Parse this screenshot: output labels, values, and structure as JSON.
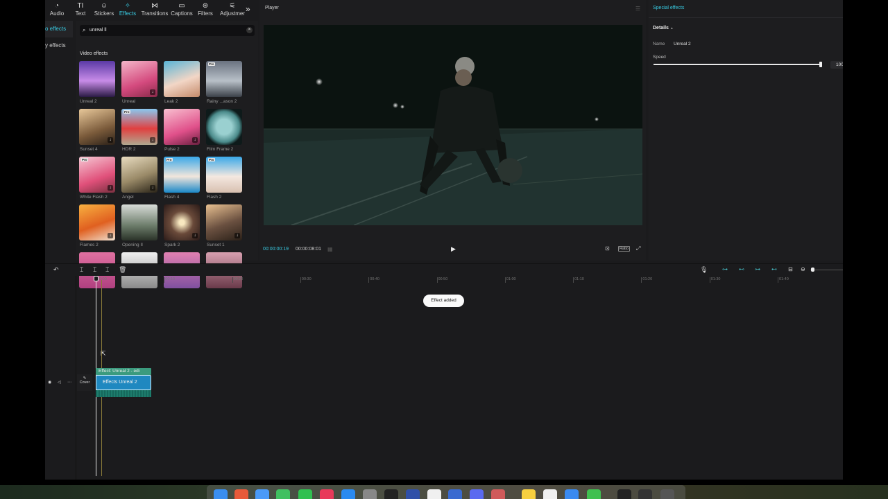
{
  "toolbar": {
    "items": [
      {
        "label": "Audio",
        "icon": "audio-icon",
        "glyph": "◔"
      },
      {
        "label": "Text",
        "icon": "text-icon",
        "glyph": "TI"
      },
      {
        "label": "Stickers",
        "icon": "stickers-icon",
        "glyph": "☺"
      },
      {
        "label": "Effects",
        "icon": "effects-icon",
        "glyph": "✧"
      },
      {
        "label": "Transitions",
        "icon": "transitions-icon",
        "glyph": "⋈"
      },
      {
        "label": "Captions",
        "icon": "captions-icon",
        "glyph": "▭"
      },
      {
        "label": "Filters",
        "icon": "filters-icon",
        "glyph": "⊛"
      },
      {
        "label": "Adjustmer",
        "icon": "adjustment-icon",
        "glyph": "⚟"
      }
    ],
    "more": "»"
  },
  "categories": [
    "o effects",
    "y effects"
  ],
  "search": {
    "value": "unreal ll",
    "clear": "×"
  },
  "section_title": "Video effects",
  "effects": [
    {
      "name": "Unreal 2",
      "bg": "linear-gradient(180deg,#5a3aa6,#c88ce8 55%,#2a1a44)",
      "pro": false,
      "dl": false
    },
    {
      "name": "Unreal",
      "bg": "linear-gradient(160deg,#f4b6c8,#d44a7e 60%,#8a2a4a)",
      "pro": false,
      "dl": true
    },
    {
      "name": "Leak 2",
      "bg": "linear-gradient(160deg,#58b4d6,#f2d6c6 55%,#c48a6a)",
      "pro": false,
      "dl": false
    },
    {
      "name": "Rainy ...ason 2",
      "bg": "linear-gradient(180deg,#6a7280,#b8c0c8 55%,#3a4048)",
      "pro": true,
      "dl": false
    },
    {
      "name": "Sunset 4",
      "bg": "linear-gradient(160deg,#e8c89a,#7a5a3a 60%,#2a2018)",
      "pro": false,
      "dl": true
    },
    {
      "name": "HDR 2",
      "bg": "linear-gradient(180deg,#8ac8f0,#e04040 55%,#b0a890)",
      "pro": true,
      "dl": true
    },
    {
      "name": "Pulse 2",
      "bg": "linear-gradient(160deg,#f8c0d0,#e0508a 60%,#6a2040)",
      "pro": false,
      "dl": true
    },
    {
      "name": "Film Frame 2",
      "bg": "radial-gradient(circle,#9ad0d0 30%,#4a8a8a 60%,#0e1a1a 75%)",
      "pro": false,
      "dl": false
    },
    {
      "name": "White Flash 2",
      "bg": "linear-gradient(160deg,#f6c8d4,#e0507a 60%,#7a3040)",
      "pro": true,
      "dl": true
    },
    {
      "name": "Angel",
      "bg": "linear-gradient(160deg,#e8dcc0,#9a8a68 55%,#2a2418)",
      "pro": false,
      "dl": true
    },
    {
      "name": "Flash 4",
      "bg": "linear-gradient(180deg,#3aa8e8,#f2e6dc 55%,#1a88c8)",
      "pro": true,
      "dl": false
    },
    {
      "name": "Flash 2",
      "bg": "linear-gradient(180deg,#3aa8e8,#f4e8e0 55%,#d8c0b0)",
      "pro": true,
      "dl": false
    },
    {
      "name": "Flames 2",
      "bg": "linear-gradient(160deg,#f8b040,#e06020 55%,#f0e0d0)",
      "pro": false,
      "dl": true
    },
    {
      "name": "Opening II",
      "bg": "linear-gradient(180deg,#d8dcd8,#6a7a68 60%,#2a3228)",
      "pro": false,
      "dl": false
    },
    {
      "name": "Spark 2",
      "bg": "radial-gradient(circle,#f8e8c0 10%,#6a4a3a 45%,#2a1a18)",
      "pro": false,
      "dl": true
    },
    {
      "name": "Sunset 1",
      "bg": "linear-gradient(160deg,#e8c090,#6a5040 55%,#2a2018)",
      "pro": false,
      "dl": true
    },
    {
      "name": "",
      "bg": "linear-gradient(180deg,#e070a0,#b04080)",
      "pro": false,
      "dl": false
    },
    {
      "name": "",
      "bg": "linear-gradient(180deg,#f0f0f0,#8a8a8a)",
      "pro": false,
      "dl": false
    },
    {
      "name": "",
      "bg": "linear-gradient(180deg,#e080b0,#8050a0)",
      "pro": false,
      "dl": false
    },
    {
      "name": "",
      "bg": "linear-gradient(180deg,#d8a0b0,#6a3a4a)",
      "pro": false,
      "dl": false
    }
  ],
  "player": {
    "title": "Player",
    "time_current": "00:00:00:19",
    "time_total": "00:00:08:01",
    "ratio": "Ratio"
  },
  "special": {
    "title": "Special effects",
    "details": "Details",
    "name_label": "Name",
    "name_value": "Unreal 2",
    "speed_label": "Speed",
    "speed_value": "100",
    "speed_fraction": 1.0
  },
  "timeline": {
    "ticks": [
      "00:00",
      "00:10",
      "00:20",
      "00:30",
      "00:40",
      "00:50",
      "01:00",
      "01:10",
      "01:20",
      "01:30",
      "01:40"
    ],
    "toast": "Effect added",
    "cover": "Cover",
    "clip_top": "Effect: Unreal 2 - edi",
    "clip_main": "Effects  Unreal 2"
  },
  "colors": {
    "accent": "#38c9e0",
    "clip_blue": "#1f88c0",
    "clip_green": "#3b9b7e"
  }
}
